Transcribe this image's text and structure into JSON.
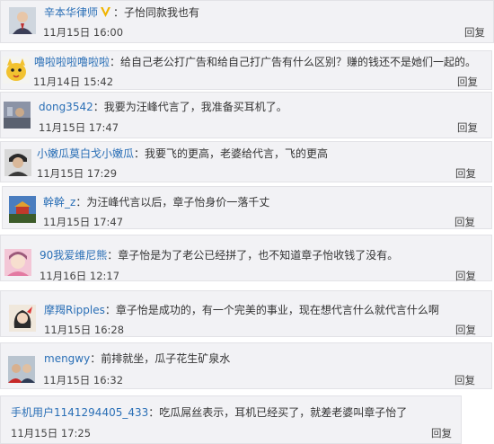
{
  "comments": [
    {
      "username": "辛本华律师",
      "separator": "：",
      "text": "子怡同款我也有",
      "time": "11月15日 16:00",
      "reply": "回复"
    },
    {
      "username": "噜啦啦啦噜啦啦",
      "separator": "：",
      "text": "给自己老公打广告和给自己打广告有什么区别？赚的钱还不是她们一起的。",
      "time": "11月14日 15:42",
      "reply": "回复"
    },
    {
      "username": "dong3542",
      "separator": "：",
      "text": "我要为汪峰代言了，我准备买耳机了。",
      "time": "11月15日 17:47",
      "reply": "回复"
    },
    {
      "username": "小嫩瓜莫白戈小嫩瓜",
      "separator": "：",
      "text": "我要飞的更高，老婆给代言，飞的更高",
      "time": "11月15日 17:29",
      "reply": "回复"
    },
    {
      "username": "幹幹_z",
      "separator": "：",
      "text": "为汪峰代言以后，章子怡身价一落千丈",
      "time": "11月15日 17:47",
      "reply": "回复"
    },
    {
      "username": "90我爱维尼熊",
      "separator": "：",
      "text": "章子怡是为了老公已经拼了，也不知道章子怡收钱了没有。",
      "time": "11月16日 12:17",
      "reply": "回复"
    },
    {
      "username": "摩羯Ripples",
      "separator": "：",
      "text": "章子怡是成功的，有一个完美的事业，现在想代言什么就代言什么啊",
      "time": "11月15日 16:28",
      "reply": "回复"
    },
    {
      "username": "mengwy",
      "separator": "：",
      "text": "前排就坐，瓜子花生矿泉水",
      "time": "11月15日 16:32",
      "reply": "回复"
    },
    {
      "username": "手机用户1141294405_433",
      "separator": "：",
      "text": "吃瓜屌丝表示，耳机已经买了，就差老婆叫章子怡了",
      "time": "11月15日 17:25",
      "reply": "回复"
    }
  ],
  "icons": {
    "verified_badge": "verified-v-badge",
    "verified_color": "#f0b400"
  },
  "colors": {
    "username": "#2a6fb6",
    "text": "#333333",
    "card_bg": "#f2f2f5"
  }
}
